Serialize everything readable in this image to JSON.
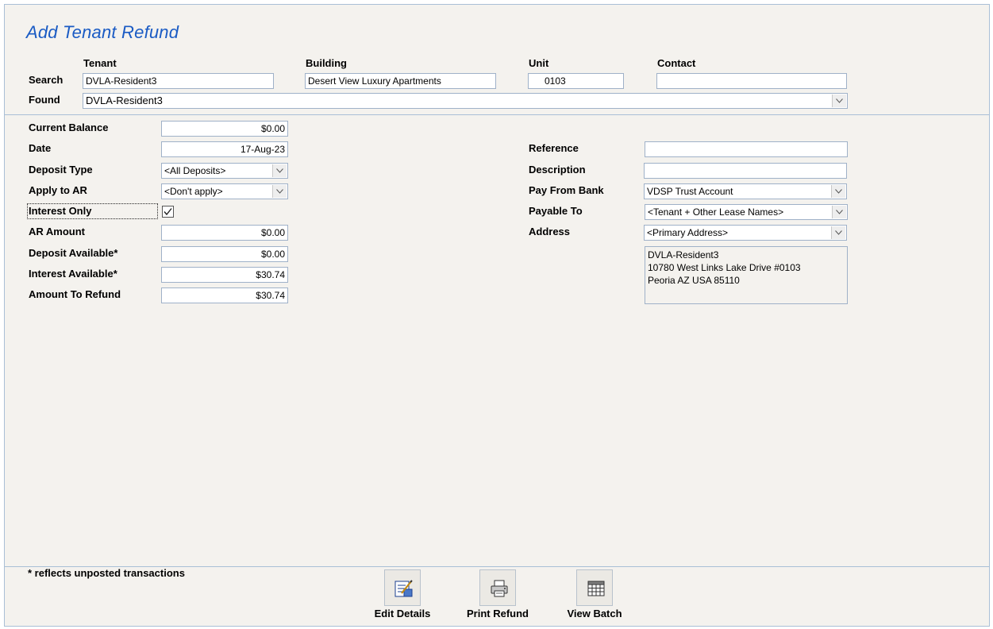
{
  "title": "Add Tenant Refund",
  "search": {
    "headers": {
      "tenant": "Tenant",
      "building": "Building",
      "unit": "Unit",
      "contact": "Contact"
    },
    "search_label": "Search",
    "found_label": "Found",
    "tenant_value": "DVLA-Resident3",
    "building_value": "Desert View Luxury Apartments",
    "unit_value": "0103",
    "contact_value": "",
    "found_value": "DVLA-Resident3"
  },
  "left_form": {
    "current_balance": {
      "label": "Current Balance",
      "value": "$0.00"
    },
    "date": {
      "label": "Date",
      "value": "17-Aug-23"
    },
    "deposit_type": {
      "label": "Deposit Type",
      "value": "<All Deposits>"
    },
    "apply_to_ar": {
      "label": "Apply to AR",
      "value": "<Don't apply>"
    },
    "interest_only": {
      "label": "Interest Only",
      "checked": true
    },
    "ar_amount": {
      "label": "AR Amount",
      "value": "$0.00"
    },
    "deposit_available": {
      "label": "Deposit Available*",
      "value": "$0.00"
    },
    "interest_available": {
      "label": "Interest Available*",
      "value": "$30.74"
    },
    "amount_to_refund": {
      "label": "Amount To Refund",
      "value": "$30.74"
    }
  },
  "right_form": {
    "reference": {
      "label": "Reference",
      "value": ""
    },
    "description": {
      "label": "Description",
      "value": ""
    },
    "pay_from_bank": {
      "label": "Pay From Bank",
      "value": "VDSP Trust Account"
    },
    "payable_to": {
      "label": "Payable To",
      "value": "<Tenant + Other Lease Names>"
    },
    "address": {
      "label": "Address",
      "value": "<Primary Address>"
    },
    "address_lines": [
      "DVLA-Resident3",
      "10780 West Links Lake Drive  #0103",
      "Peoria  AZ  USA  85110"
    ]
  },
  "footnote": "* reflects unposted transactions",
  "toolbar": {
    "edit_details": "Edit Details",
    "print_refund": "Print Refund",
    "view_batch": "View Batch"
  },
  "icons": {
    "dropdown": "chevron-down-icon",
    "edit": "edit-details-icon",
    "print": "printer-icon",
    "batch": "grid-icon"
  },
  "colors": {
    "title": "#1a5bc4",
    "background": "#f4f2ee",
    "border": "#a9bfd6"
  }
}
